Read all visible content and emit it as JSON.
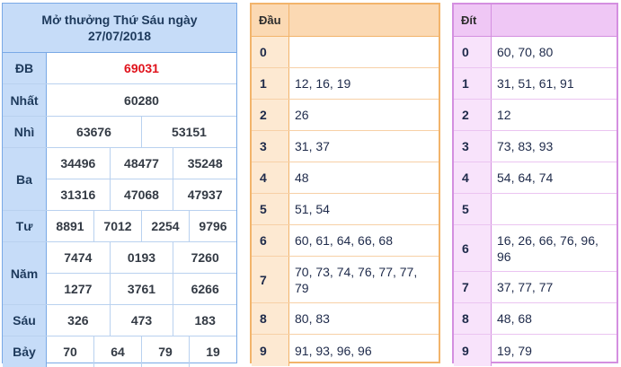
{
  "results": {
    "title_line1": "Mở thưởng Thứ Sáu ngày",
    "title_line2": "27/07/2018",
    "prizes": [
      {
        "label": "ĐB",
        "lines": [
          [
            "69031"
          ]
        ]
      },
      {
        "label": "Nhất",
        "lines": [
          [
            "60280"
          ]
        ]
      },
      {
        "label": "Nhì",
        "lines": [
          [
            "63676",
            "53151"
          ]
        ]
      },
      {
        "label": "Ba",
        "lines": [
          [
            "34496",
            "48477",
            "35248"
          ],
          [
            "31316",
            "47068",
            "47937"
          ]
        ]
      },
      {
        "label": "Tư",
        "lines": [
          [
            "8891",
            "7012",
            "2254",
            "9796"
          ]
        ]
      },
      {
        "label": "Năm",
        "lines": [
          [
            "7474",
            "0193",
            "7260"
          ],
          [
            "1277",
            "3761",
            "6266"
          ]
        ]
      },
      {
        "label": "Sáu",
        "lines": [
          [
            "326",
            "473",
            "183"
          ]
        ]
      },
      {
        "label": "Bảy",
        "lines": [
          [
            "70",
            "64",
            "79",
            "19"
          ]
        ]
      }
    ]
  },
  "dau": {
    "header": "Đầu",
    "rows": [
      {
        "key": "0",
        "value": ""
      },
      {
        "key": "1",
        "value": "12, 16, 19"
      },
      {
        "key": "2",
        "value": "26"
      },
      {
        "key": "3",
        "value": "31, 37"
      },
      {
        "key": "4",
        "value": "48"
      },
      {
        "key": "5",
        "value": "51, 54"
      },
      {
        "key": "6",
        "value": "60, 61, 64, 66, 68"
      },
      {
        "key": "7",
        "value": "70, 73, 74, 76, 77, 77, 79"
      },
      {
        "key": "8",
        "value": "80, 83"
      },
      {
        "key": "9",
        "value": "91, 93, 96, 96"
      }
    ]
  },
  "dit": {
    "header": "Đít",
    "rows": [
      {
        "key": "0",
        "value": "60, 70, 80"
      },
      {
        "key": "1",
        "value": "31, 51, 61, 91"
      },
      {
        "key": "2",
        "value": "12"
      },
      {
        "key": "3",
        "value": "73, 83, 93"
      },
      {
        "key": "4",
        "value": "54, 64, 74"
      },
      {
        "key": "5",
        "value": ""
      },
      {
        "key": "6",
        "value": "16, 26, 66, 76, 96, 96"
      },
      {
        "key": "7",
        "value": "37, 77, 77"
      },
      {
        "key": "8",
        "value": "48, 68"
      },
      {
        "key": "9",
        "value": "19, 79"
      }
    ]
  },
  "colors": {
    "special_prize": "#e0121b",
    "results_accent": "#79a9e6",
    "dau_accent": "#f2b46b",
    "dit_accent": "#d48fe0"
  }
}
